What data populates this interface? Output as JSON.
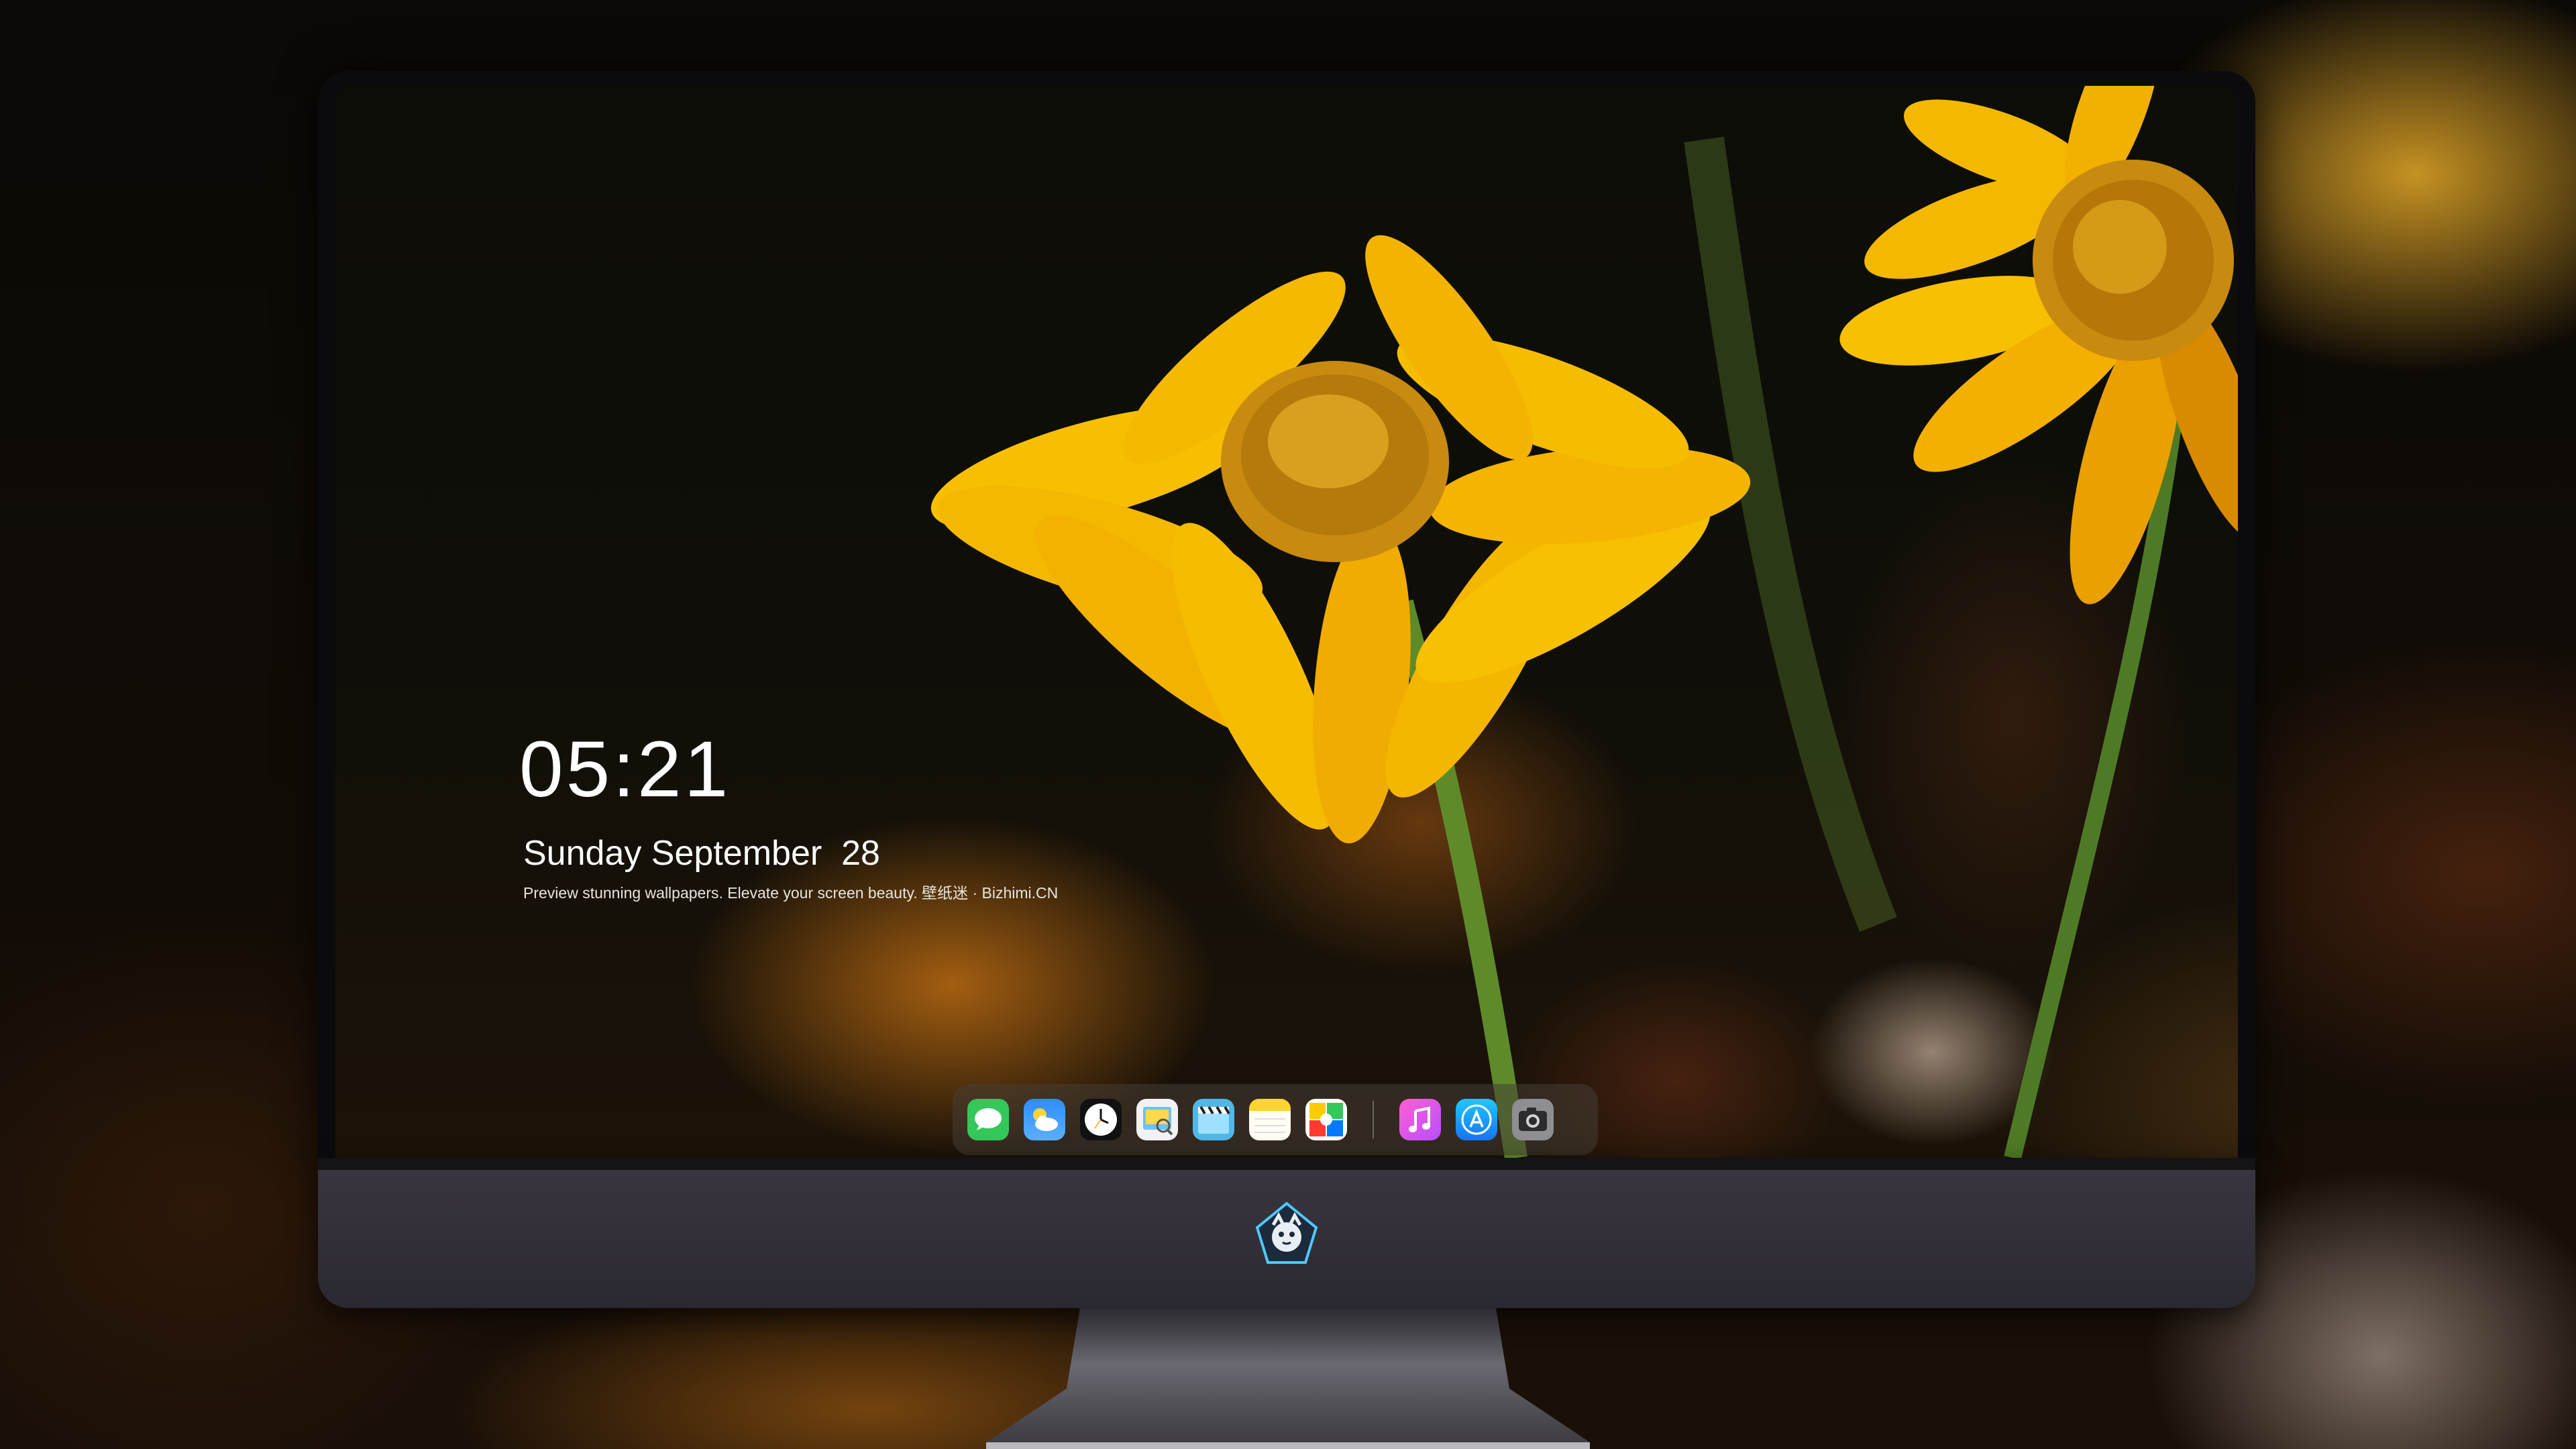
{
  "lock_screen": {
    "time": "05:21",
    "date": "Sunday September  28",
    "tagline": "Preview stunning wallpapers. Elevate your screen beauty. 壁纸迷 · Bizhimi.CN"
  },
  "dock": {
    "apps": [
      {
        "name": "messages-icon"
      },
      {
        "name": "weather-icon"
      },
      {
        "name": "clock-icon"
      },
      {
        "name": "preview-icon"
      },
      {
        "name": "clips-icon"
      },
      {
        "name": "notes-icon"
      },
      {
        "name": "photo-booth-icon"
      },
      {
        "name": "music-icon"
      },
      {
        "name": "app-store-icon"
      },
      {
        "name": "camera-icon"
      }
    ]
  },
  "colors": {
    "petal": "#f5b800",
    "petal_dark": "#e08a00",
    "flower_center": "#c98a10",
    "stem": "#5f8a2a",
    "bezel": "#0b0b0d",
    "chin": "#34313a"
  }
}
